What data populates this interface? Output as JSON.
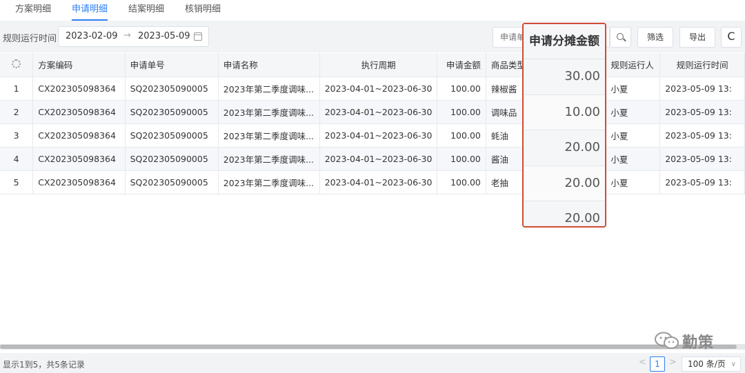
{
  "tabs": [
    "方案明细",
    "申请明细",
    "结案明细",
    "核销明细"
  ],
  "toolbar": {
    "date_label": "规则运行时间",
    "date_start": "2023-02-09",
    "date_arrow": "→",
    "date_end": "2023-05-09",
    "search_placeholder": "申请单",
    "filter_label": "筛选",
    "export_label": "导出",
    "refresh_label": "C"
  },
  "table": {
    "headers": [
      "",
      "方案编码",
      "申请单号",
      "申请名称",
      "执行周期",
      "申请金额",
      "商品类型",
      "",
      "规则运行人",
      "规则运行时间"
    ],
    "rows": [
      {
        "idx": "1",
        "code": "CX202305098364",
        "order": "SQ202305090005",
        "name": "2023年第二季度调味...",
        "period": "2023-04-01~2023-06-30",
        "amount": "100.00",
        "type": "辣椒酱",
        "runner": "小夏",
        "time": "2023-05-09 13:"
      },
      {
        "idx": "2",
        "code": "CX202305098364",
        "order": "SQ202305090005",
        "name": "2023年第二季度调味...",
        "period": "2023-04-01~2023-06-30",
        "amount": "100.00",
        "type": "调味品",
        "runner": "小夏",
        "time": "2023-05-09 13:"
      },
      {
        "idx": "3",
        "code": "CX202305098364",
        "order": "SQ202305090005",
        "name": "2023年第二季度调味...",
        "period": "2023-04-01~2023-06-30",
        "amount": "100.00",
        "type": "蚝油",
        "runner": "小夏",
        "time": "2023-05-09 13:"
      },
      {
        "idx": "4",
        "code": "CX202305098364",
        "order": "SQ202305090005",
        "name": "2023年第二季度调味...",
        "period": "2023-04-01~2023-06-30",
        "amount": "100.00",
        "type": "酱油",
        "runner": "小夏",
        "time": "2023-05-09 13:"
      },
      {
        "idx": "5",
        "code": "CX202305098364",
        "order": "SQ202305090005",
        "name": "2023年第二季度调味...",
        "period": "2023-04-01~2023-06-30",
        "amount": "100.00",
        "type": "老抽",
        "runner": "小夏",
        "time": "2023-05-09 13:"
      }
    ]
  },
  "highlight": {
    "title": "申请分摊金额",
    "values": [
      "30.00",
      "10.00",
      "20.00",
      "20.00",
      "20.00"
    ],
    "border_color": "#d04a35"
  },
  "footer": {
    "total_text": "显示1到5，共5条记录",
    "prev": "<",
    "current_page": "1",
    "next": ">",
    "page_size": "100 条/页"
  },
  "watermark": {
    "text": "勤策",
    "icon": "wechat-logo-icon"
  },
  "colors": {
    "accent": "#2d7ef5",
    "highlight_border": "#d04a35"
  }
}
